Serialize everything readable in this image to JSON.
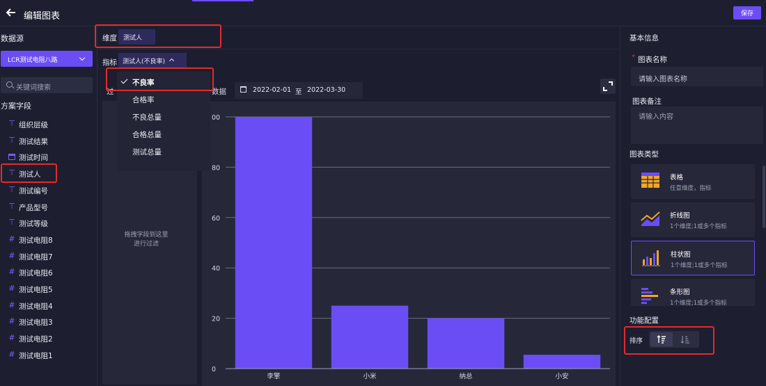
{
  "header": {
    "title": "编辑图表",
    "save_label": "保存"
  },
  "left": {
    "datasource_label": "数据源",
    "datasource_value": "LCR测试电阻八路",
    "search_placeholder": "关键词搜索",
    "fields_label": "方案字段",
    "fields": [
      {
        "name": "组织层级",
        "icon": "text-type-icon"
      },
      {
        "name": "测试结果",
        "icon": "text-type-icon"
      },
      {
        "name": "测试时间",
        "icon": "calendar-type-icon"
      },
      {
        "name": "测试人",
        "icon": "text-type-icon"
      },
      {
        "name": "测试编号",
        "icon": "text-type-icon"
      },
      {
        "name": "产品型号",
        "icon": "text-type-icon"
      },
      {
        "name": "测试等级",
        "icon": "text-type-icon"
      },
      {
        "name": "测试电阻8",
        "icon": "number-type-icon"
      },
      {
        "name": "测试电阻7",
        "icon": "number-type-icon"
      },
      {
        "name": "测试电阻6",
        "icon": "number-type-icon"
      },
      {
        "name": "测试电阻5",
        "icon": "number-type-icon"
      },
      {
        "name": "测试电阻4",
        "icon": "number-type-icon"
      },
      {
        "name": "测试电阻3",
        "icon": "number-type-icon"
      },
      {
        "name": "测试电阻2",
        "icon": "number-type-icon"
      },
      {
        "name": "测试电阻1",
        "icon": "number-type-icon"
      }
    ]
  },
  "config": {
    "dimension_label": "维度",
    "dimension_value": "测试人",
    "indicator_label": "指标",
    "indicator_value": "测试人(不良率)",
    "indicator_options": [
      "不良率",
      "合格率",
      "不良总量",
      "合格总量",
      "测试总量"
    ],
    "indicator_selected": "不良率",
    "filter_label_partial": "过",
    "filter_hint": [
      "拖拽字段到这里",
      "进行过滤"
    ],
    "data_label_partial": "数据",
    "date_start": "2022-02-01",
    "date_sep": "至",
    "date_end": "2022-03-30"
  },
  "chart_data": {
    "type": "bar",
    "categories": [
      "李擎",
      "小米",
      "纳总",
      "小安"
    ],
    "values": [
      100,
      25,
      20,
      5.5
    ],
    "ylim": [
      0,
      100
    ],
    "yticks": [
      "0",
      "20",
      "40",
      "60",
      "80",
      "00"
    ],
    "grid": true,
    "bar_color": "#6b4df5"
  },
  "right": {
    "basic_info_label": "基本信息",
    "chart_name_label": "图表名称",
    "chart_name_placeholder": "请输入图表名称",
    "chart_note_label": "图表备注",
    "chart_note_placeholder": "请输入内容",
    "chart_type_label": "图表类型",
    "chart_types": [
      {
        "title": "表格",
        "desc": "任意维度，指标",
        "icon": "table-chart-icon"
      },
      {
        "title": "折线图",
        "desc": "1个维度;1或多个指标",
        "icon": "line-chart-icon"
      },
      {
        "title": "柱状图",
        "desc": "1个维度;1或多个指标",
        "icon": "bar-chart-icon",
        "active": true
      },
      {
        "title": "条形图",
        "desc": "1个维度;1或多个指标",
        "icon": "horizontal-bar-chart-icon"
      }
    ],
    "feature_label": "功能配置",
    "sort_label": "排序"
  },
  "colors": {
    "accent": "#6b4df5",
    "highlight": "#e42b2b",
    "bg": "#1c1e2f",
    "panel": "#26283a"
  }
}
